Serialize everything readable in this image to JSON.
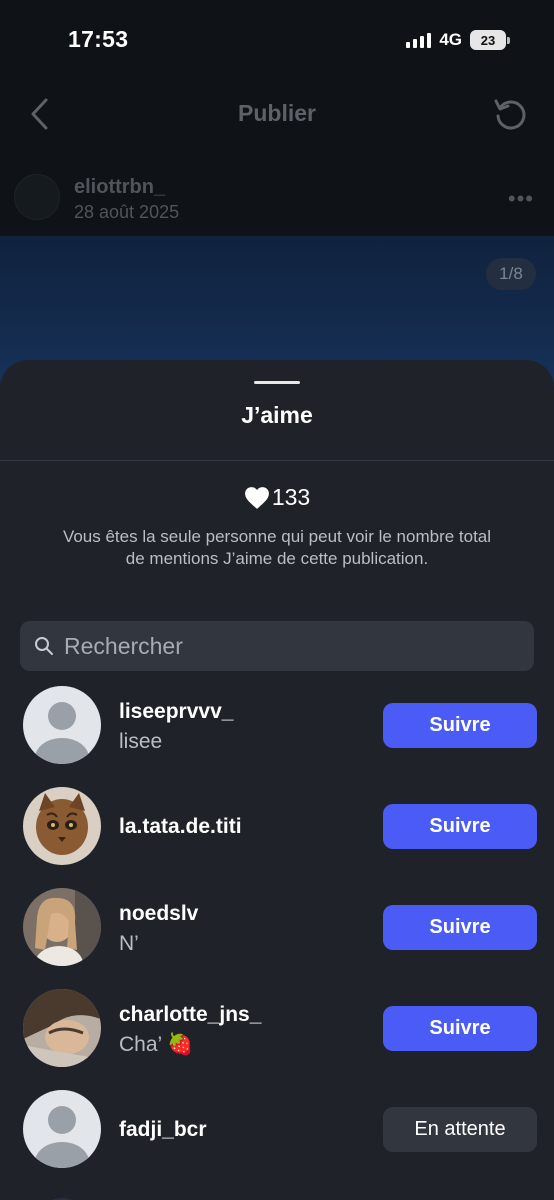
{
  "status_bar": {
    "time": "17:53",
    "network": "4G",
    "battery": "23"
  },
  "nav": {
    "title": "Publier",
    "back_icon": "chevron-left-icon",
    "refresh_icon": "refresh-icon"
  },
  "post": {
    "username": "eliottrbn_",
    "date": "28 août 2025",
    "page_indicator": "1/8"
  },
  "sheet": {
    "title": "J’aime",
    "likes_count": "133",
    "privacy_note": "Vous êtes la seule personne qui peut voir le nombre total de mentions J’aime de cette publication.",
    "search_placeholder": "Rechercher"
  },
  "users": [
    {
      "username": "liseeprvvv_",
      "fullname": "lisee",
      "button": "Suivre",
      "button_style": "follow",
      "avatar": "default"
    },
    {
      "username": "la.tata.de.titi",
      "fullname": "",
      "button": "Suivre",
      "button_style": "follow",
      "avatar": "cat"
    },
    {
      "username": "noedslv",
      "fullname": "N’",
      "button": "Suivre",
      "button_style": "follow",
      "avatar": "photo-blonde"
    },
    {
      "username": "charlotte_jns_",
      "fullname": "Cha’ 🍓",
      "button": "Suivre",
      "button_style": "follow",
      "avatar": "photo-brunette"
    },
    {
      "username": "fadji_bcr",
      "fullname": "",
      "button": "En attente",
      "button_style": "pending",
      "avatar": "default"
    }
  ],
  "colors": {
    "accent": "#4a5cf5",
    "sheet_bg": "#1f2329",
    "search_bg": "#32373f"
  }
}
